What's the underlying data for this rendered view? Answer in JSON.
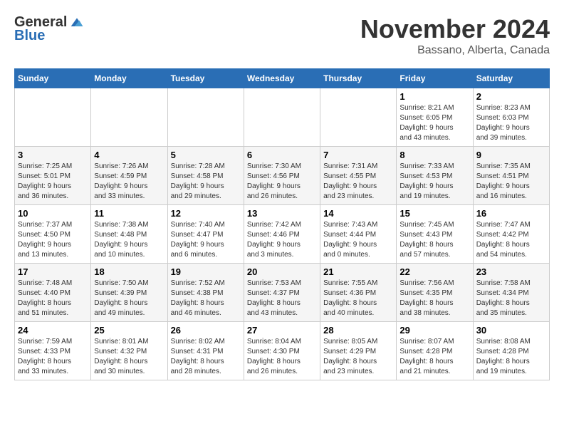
{
  "logo": {
    "general": "General",
    "blue": "Blue"
  },
  "title": "November 2024",
  "location": "Bassano, Alberta, Canada",
  "days_of_week": [
    "Sunday",
    "Monday",
    "Tuesday",
    "Wednesday",
    "Thursday",
    "Friday",
    "Saturday"
  ],
  "weeks": [
    [
      {
        "day": "",
        "info": ""
      },
      {
        "day": "",
        "info": ""
      },
      {
        "day": "",
        "info": ""
      },
      {
        "day": "",
        "info": ""
      },
      {
        "day": "",
        "info": ""
      },
      {
        "day": "1",
        "info": "Sunrise: 8:21 AM\nSunset: 6:05 PM\nDaylight: 9 hours\nand 43 minutes."
      },
      {
        "day": "2",
        "info": "Sunrise: 8:23 AM\nSunset: 6:03 PM\nDaylight: 9 hours\nand 39 minutes."
      }
    ],
    [
      {
        "day": "3",
        "info": "Sunrise: 7:25 AM\nSunset: 5:01 PM\nDaylight: 9 hours\nand 36 minutes."
      },
      {
        "day": "4",
        "info": "Sunrise: 7:26 AM\nSunset: 4:59 PM\nDaylight: 9 hours\nand 33 minutes."
      },
      {
        "day": "5",
        "info": "Sunrise: 7:28 AM\nSunset: 4:58 PM\nDaylight: 9 hours\nand 29 minutes."
      },
      {
        "day": "6",
        "info": "Sunrise: 7:30 AM\nSunset: 4:56 PM\nDaylight: 9 hours\nand 26 minutes."
      },
      {
        "day": "7",
        "info": "Sunrise: 7:31 AM\nSunset: 4:55 PM\nDaylight: 9 hours\nand 23 minutes."
      },
      {
        "day": "8",
        "info": "Sunrise: 7:33 AM\nSunset: 4:53 PM\nDaylight: 9 hours\nand 19 minutes."
      },
      {
        "day": "9",
        "info": "Sunrise: 7:35 AM\nSunset: 4:51 PM\nDaylight: 9 hours\nand 16 minutes."
      }
    ],
    [
      {
        "day": "10",
        "info": "Sunrise: 7:37 AM\nSunset: 4:50 PM\nDaylight: 9 hours\nand 13 minutes."
      },
      {
        "day": "11",
        "info": "Sunrise: 7:38 AM\nSunset: 4:48 PM\nDaylight: 9 hours\nand 10 minutes."
      },
      {
        "day": "12",
        "info": "Sunrise: 7:40 AM\nSunset: 4:47 PM\nDaylight: 9 hours\nand 6 minutes."
      },
      {
        "day": "13",
        "info": "Sunrise: 7:42 AM\nSunset: 4:46 PM\nDaylight: 9 hours\nand 3 minutes."
      },
      {
        "day": "14",
        "info": "Sunrise: 7:43 AM\nSunset: 4:44 PM\nDaylight: 9 hours\nand 0 minutes."
      },
      {
        "day": "15",
        "info": "Sunrise: 7:45 AM\nSunset: 4:43 PM\nDaylight: 8 hours\nand 57 minutes."
      },
      {
        "day": "16",
        "info": "Sunrise: 7:47 AM\nSunset: 4:42 PM\nDaylight: 8 hours\nand 54 minutes."
      }
    ],
    [
      {
        "day": "17",
        "info": "Sunrise: 7:48 AM\nSunset: 4:40 PM\nDaylight: 8 hours\nand 51 minutes."
      },
      {
        "day": "18",
        "info": "Sunrise: 7:50 AM\nSunset: 4:39 PM\nDaylight: 8 hours\nand 49 minutes."
      },
      {
        "day": "19",
        "info": "Sunrise: 7:52 AM\nSunset: 4:38 PM\nDaylight: 8 hours\nand 46 minutes."
      },
      {
        "day": "20",
        "info": "Sunrise: 7:53 AM\nSunset: 4:37 PM\nDaylight: 8 hours\nand 43 minutes."
      },
      {
        "day": "21",
        "info": "Sunrise: 7:55 AM\nSunset: 4:36 PM\nDaylight: 8 hours\nand 40 minutes."
      },
      {
        "day": "22",
        "info": "Sunrise: 7:56 AM\nSunset: 4:35 PM\nDaylight: 8 hours\nand 38 minutes."
      },
      {
        "day": "23",
        "info": "Sunrise: 7:58 AM\nSunset: 4:34 PM\nDaylight: 8 hours\nand 35 minutes."
      }
    ],
    [
      {
        "day": "24",
        "info": "Sunrise: 7:59 AM\nSunset: 4:33 PM\nDaylight: 8 hours\nand 33 minutes."
      },
      {
        "day": "25",
        "info": "Sunrise: 8:01 AM\nSunset: 4:32 PM\nDaylight: 8 hours\nand 30 minutes."
      },
      {
        "day": "26",
        "info": "Sunrise: 8:02 AM\nSunset: 4:31 PM\nDaylight: 8 hours\nand 28 minutes."
      },
      {
        "day": "27",
        "info": "Sunrise: 8:04 AM\nSunset: 4:30 PM\nDaylight: 8 hours\nand 26 minutes."
      },
      {
        "day": "28",
        "info": "Sunrise: 8:05 AM\nSunset: 4:29 PM\nDaylight: 8 hours\nand 23 minutes."
      },
      {
        "day": "29",
        "info": "Sunrise: 8:07 AM\nSunset: 4:28 PM\nDaylight: 8 hours\nand 21 minutes."
      },
      {
        "day": "30",
        "info": "Sunrise: 8:08 AM\nSunset: 4:28 PM\nDaylight: 8 hours\nand 19 minutes."
      }
    ]
  ]
}
